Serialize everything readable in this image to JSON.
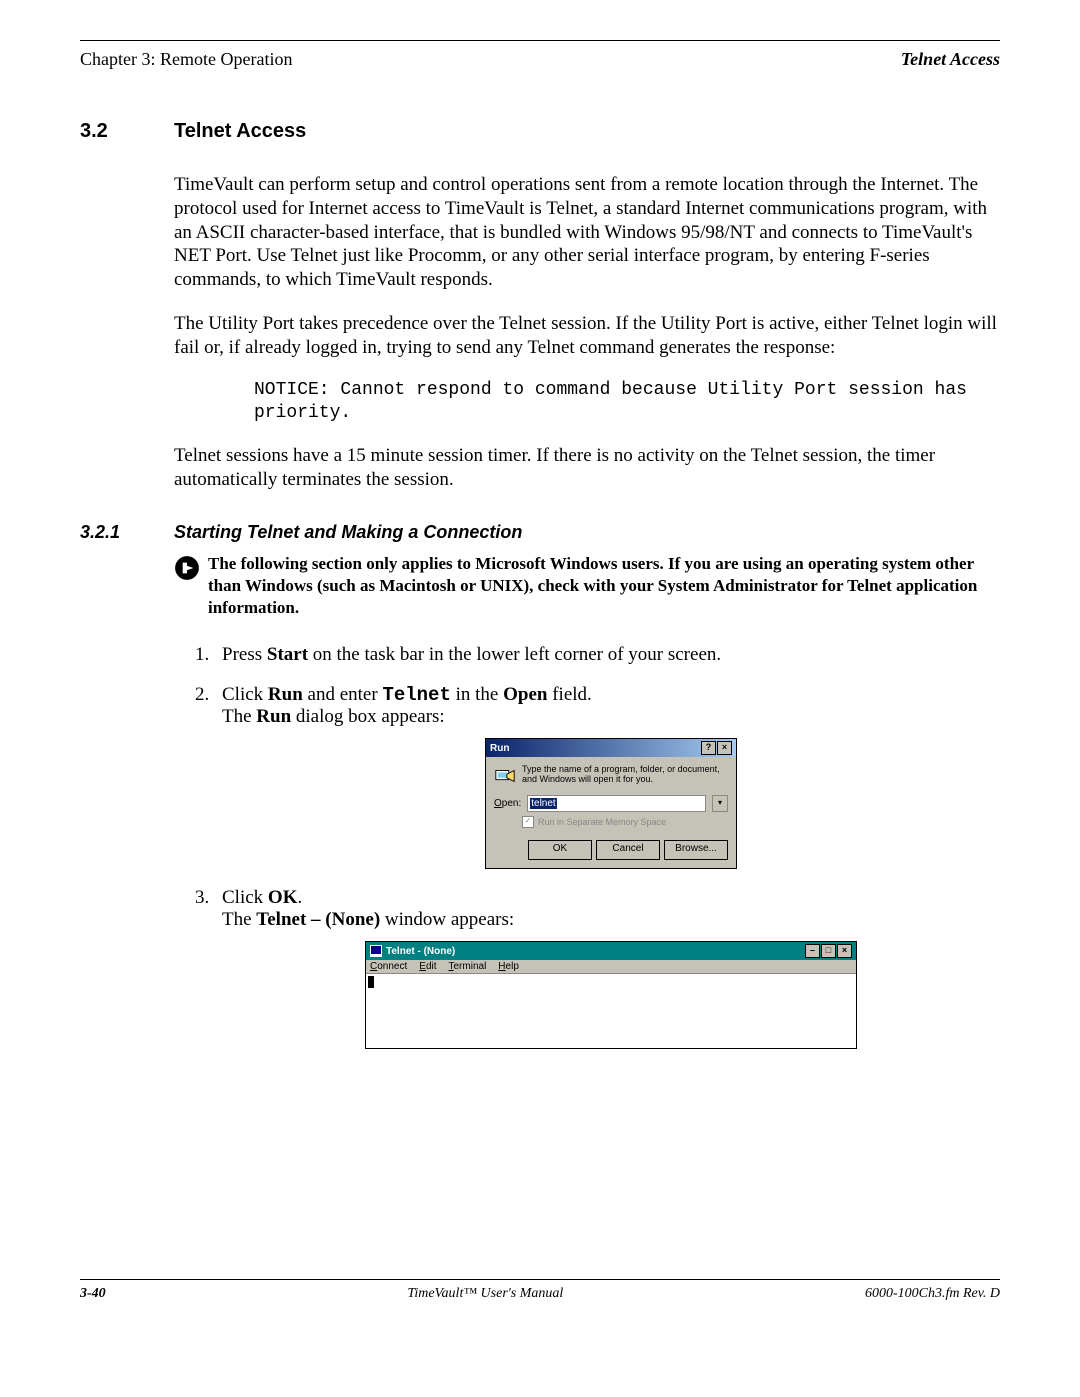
{
  "header": {
    "left": "Chapter 3: Remote Operation",
    "right": "Telnet Access"
  },
  "section": {
    "num": "3.2",
    "title": "Telnet Access"
  },
  "para1": "TimeVault can perform setup and control operations sent from a remote location through the Internet.  The protocol used for Internet access to TimeVault is Telnet, a standard Internet communications program, with an ASCII character-based interface, that is bundled with Windows 95/98/NT and connects to TimeVault's NET Port. Use Telnet just like Procomm, or any other serial interface program, by entering F-series commands, to which TimeVault responds.",
  "para2": "The Utility Port takes precedence over the Telnet session.  If the Utility Port is active, either Telnet login will fail or, if already logged in, trying to send any Telnet command generates the response:",
  "notice": "NOTICE: Cannot respond to command because Utility Port session has priority.",
  "para3": "Telnet sessions have a 15 minute session timer.  If there is no activity on the Telnet session, the timer automatically terminates the session.",
  "subsection": {
    "num": "3.2.1",
    "title": "Starting Telnet and Making a Connection"
  },
  "note": "The following section only applies to Microsoft Windows users.  If you are using an operating system other than Windows (such as Macintosh or UNIX), check with your System Administrator for Telnet application information.",
  "steps": {
    "s1_pre": "Press ",
    "s1_b1": "Start",
    "s1_post": " on the task bar in the lower left corner of your screen.",
    "s2_pre": "Click ",
    "s2_b1": "Run",
    "s2_mid1": " and enter ",
    "s2_code": "Telnet",
    "s2_mid2": " in the ",
    "s2_b2": "Open",
    "s2_post": " field.",
    "s2_line2_pre": "The ",
    "s2_line2_b": "Run",
    "s2_line2_post": " dialog box appears:",
    "s3_pre": "Click ",
    "s3_b1": "OK",
    "s3_post": ".",
    "s3_line2_pre": "The ",
    "s3_line2_b": "Telnet – (None)",
    "s3_line2_post": " window appears:"
  },
  "runDialog": {
    "title": "Run",
    "help": "?",
    "close": "×",
    "desc": "Type the name of a program, folder, or document, and Windows will open it for you.",
    "openLabel": "Open:",
    "openValue": "telnet",
    "checkboxLabel": "Run in Separate Memory Space",
    "ok": "OK",
    "cancel": "Cancel",
    "browse": "Browse..."
  },
  "telnetWindow": {
    "title": "Telnet - (None)",
    "min": "–",
    "max": "□",
    "close": "×",
    "menu": {
      "connect": "Connect",
      "edit": "Edit",
      "terminal": "Terminal",
      "help": "Help"
    }
  },
  "footer": {
    "left": "3-40",
    "center": "TimeVault™ User's Manual",
    "right": "6000-100Ch3.fm  Rev. D"
  }
}
